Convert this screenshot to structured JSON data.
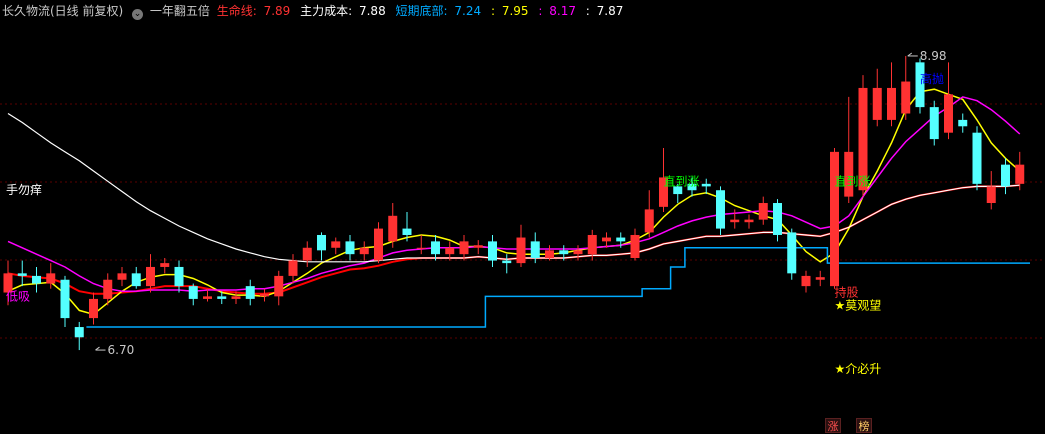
{
  "header": {
    "stock_name": "长久物流(日线 前复权)",
    "indicator_name": "一年翻五倍",
    "life_line_label": "生命线:",
    "life_line_value": "7.89",
    "main_cost_label": "主力成本:",
    "main_cost_value": "7.88",
    "short_bottom_label": "短期底部:",
    "short_bottom_v1": "7.24",
    "sep1": ":",
    "short_bottom_v2": "7.95",
    "sep2": ":",
    "short_bottom_v3": "8.17",
    "sep3": ":",
    "short_bottom_v4": "7.87"
  },
  "colors": {
    "up": "#ff3232",
    "down": "#54ffff",
    "ma_short": "#ffff00",
    "ma_mid": "#ff00ff",
    "life_line": "#ff0000",
    "main_cost": "#ffffff",
    "bottom_line": "#00aaff"
  },
  "badges": {
    "zhang": "涨",
    "bang": "榜"
  },
  "chart_data": {
    "type": "candlestick",
    "ylim": [
      6.2,
      9.25
    ],
    "candles": [
      [
        7.15,
        7.3,
        7.4,
        7.05
      ],
      [
        7.3,
        7.28,
        7.4,
        7.2
      ],
      [
        7.28,
        7.22,
        7.35,
        7.15
      ],
      [
        7.22,
        7.3,
        7.38,
        7.18
      ],
      [
        7.25,
        6.95,
        7.28,
        6.88
      ],
      [
        6.88,
        6.8,
        6.92,
        6.7
      ],
      [
        6.95,
        7.1,
        7.15,
        6.9
      ],
      [
        7.1,
        7.25,
        7.3,
        7.05
      ],
      [
        7.25,
        7.3,
        7.35,
        7.2
      ],
      [
        7.3,
        7.2,
        7.35,
        7.18
      ],
      [
        7.2,
        7.35,
        7.45,
        7.15
      ],
      [
        7.35,
        7.38,
        7.42,
        7.3
      ],
      [
        7.35,
        7.2,
        7.4,
        7.15
      ],
      [
        7.2,
        7.1,
        7.22,
        7.05
      ],
      [
        7.1,
        7.12,
        7.18,
        7.08
      ],
      [
        7.12,
        7.1,
        7.16,
        7.06
      ],
      [
        7.1,
        7.12,
        7.16,
        7.06
      ],
      [
        7.2,
        7.1,
        7.25,
        7.05
      ],
      [
        7.12,
        7.14,
        7.18,
        7.08
      ],
      [
        7.12,
        7.28,
        7.32,
        7.05
      ],
      [
        7.28,
        7.4,
        7.45,
        7.22
      ],
      [
        7.4,
        7.5,
        7.55,
        7.35
      ],
      [
        7.6,
        7.48,
        7.62,
        7.4
      ],
      [
        7.5,
        7.55,
        7.58,
        7.45
      ],
      [
        7.55,
        7.45,
        7.6,
        7.4
      ],
      [
        7.45,
        7.5,
        7.55,
        7.4
      ],
      [
        7.4,
        7.65,
        7.7,
        7.38
      ],
      [
        7.55,
        7.75,
        7.85,
        7.5
      ],
      [
        7.65,
        7.6,
        7.78,
        7.55
      ],
      [
        7.5,
        7.5,
        7.6,
        7.45
      ],
      [
        7.55,
        7.45,
        7.6,
        7.4
      ],
      [
        7.45,
        7.5,
        7.55,
        7.4
      ],
      [
        7.45,
        7.55,
        7.6,
        7.4
      ],
      [
        7.5,
        7.52,
        7.56,
        7.45
      ],
      [
        7.55,
        7.4,
        7.6,
        7.35
      ],
      [
        7.4,
        7.38,
        7.45,
        7.3
      ],
      [
        7.38,
        7.58,
        7.68,
        7.35
      ],
      [
        7.55,
        7.42,
        7.62,
        7.38
      ],
      [
        7.42,
        7.48,
        7.52,
        7.4
      ],
      [
        7.48,
        7.45,
        7.52,
        7.4
      ],
      [
        7.45,
        7.48,
        7.52,
        7.4
      ],
      [
        7.45,
        7.6,
        7.64,
        7.4
      ],
      [
        7.55,
        7.58,
        7.62,
        7.5
      ],
      [
        7.58,
        7.55,
        7.62,
        7.5
      ],
      [
        7.42,
        7.6,
        7.65,
        7.4
      ],
      [
        7.62,
        7.8,
        7.95,
        7.58
      ],
      [
        7.82,
        8.05,
        8.28,
        7.78
      ],
      [
        7.98,
        7.92,
        8.0,
        7.85
      ],
      [
        8.0,
        7.95,
        8.05,
        7.9
      ],
      [
        8.0,
        7.98,
        8.04,
        7.92
      ],
      [
        7.95,
        7.65,
        7.98,
        7.6
      ],
      [
        7.7,
        7.72,
        7.8,
        7.65
      ],
      [
        7.7,
        7.72,
        7.76,
        7.65
      ],
      [
        7.72,
        7.85,
        7.9,
        7.68
      ],
      [
        7.85,
        7.6,
        7.88,
        7.55
      ],
      [
        7.62,
        7.3,
        7.65,
        7.25
      ],
      [
        7.2,
        7.28,
        7.32,
        7.15
      ],
      [
        7.25,
        7.27,
        7.32,
        7.2
      ],
      [
        7.2,
        8.25,
        8.28,
        7.18
      ],
      [
        7.9,
        8.25,
        8.68,
        7.85
      ],
      [
        7.95,
        8.75,
        8.85,
        7.9
      ],
      [
        8.5,
        8.75,
        8.9,
        8.45
      ],
      [
        8.5,
        8.75,
        8.95,
        8.45
      ],
      [
        8.55,
        8.8,
        9.0,
        8.5
      ],
      [
        8.95,
        8.6,
        8.98,
        8.55
      ],
      [
        8.6,
        8.35,
        8.65,
        8.3
      ],
      [
        8.4,
        8.7,
        8.95,
        8.35
      ],
      [
        8.5,
        8.45,
        8.55,
        8.4
      ],
      [
        8.4,
        8.0,
        8.45,
        7.95
      ],
      [
        7.85,
        7.98,
        8.1,
        7.8
      ],
      [
        8.15,
        7.98,
        8.2,
        7.92
      ],
      [
        8.0,
        8.15,
        8.25,
        7.95
      ]
    ],
    "series": [
      {
        "name": "生命线",
        "values": [
          7.3,
          7.28,
          7.27,
          7.26,
          7.22,
          7.16,
          7.14,
          7.14,
          7.15,
          7.16,
          7.18,
          7.2,
          7.2,
          7.2,
          7.18,
          7.16,
          7.15,
          7.14,
          7.14,
          7.15,
          7.19,
          7.23,
          7.27,
          7.3,
          7.33,
          7.34,
          7.36,
          7.39,
          7.41,
          7.42,
          7.42,
          7.42,
          7.42,
          7.43,
          7.42,
          7.41,
          7.42,
          7.42,
          7.42,
          7.42,
          7.43,
          7.44,
          7.44,
          7.45,
          7.46,
          7.49,
          7.53,
          7.55,
          7.57,
          7.59,
          7.59,
          7.6,
          7.61,
          7.62,
          7.62,
          7.61,
          7.6,
          7.59,
          7.62,
          7.66,
          7.72,
          7.78,
          7.84,
          7.88,
          7.91,
          7.93,
          7.95,
          7.97,
          7.98,
          7.98,
          7.98,
          7.99
        ]
      },
      {
        "name": "",
        "values": [
          7.16,
          7.21,
          7.22,
          7.23,
          7.14,
          7.01,
          6.98,
          7.07,
          7.16,
          7.23,
          7.27,
          7.29,
          7.29,
          7.26,
          7.21,
          7.15,
          7.13,
          7.13,
          7.12,
          7.16,
          7.23,
          7.3,
          7.38,
          7.43,
          7.48,
          7.5,
          7.51,
          7.55,
          7.58,
          7.6,
          7.59,
          7.56,
          7.51,
          7.51,
          7.5,
          7.46,
          7.45,
          7.45,
          7.45,
          7.46,
          7.48,
          7.5,
          7.51,
          7.52,
          7.56,
          7.62,
          7.74,
          7.84,
          7.91,
          7.93,
          7.89,
          7.83,
          7.79,
          7.75,
          7.72,
          7.6,
          7.47,
          7.39,
          7.46,
          7.65,
          7.9,
          8.1,
          8.32,
          8.58,
          8.72,
          8.74,
          8.7,
          8.66,
          8.5,
          8.32,
          8.2,
          8.1
        ]
      },
      {
        "name": "",
        "values": [
          7.55,
          7.5,
          7.45,
          7.4,
          7.35,
          7.28,
          7.22,
          7.18,
          7.16,
          7.16,
          7.17,
          7.17,
          7.17,
          7.16,
          7.17,
          7.17,
          7.17,
          7.18,
          7.18,
          7.2,
          7.23,
          7.26,
          7.3,
          7.33,
          7.36,
          7.38,
          7.42,
          7.46,
          7.48,
          7.49,
          7.5,
          7.5,
          7.5,
          7.51,
          7.5,
          7.49,
          7.49,
          7.49,
          7.49,
          7.49,
          7.49,
          7.5,
          7.51,
          7.52,
          7.54,
          7.57,
          7.62,
          7.67,
          7.71,
          7.74,
          7.76,
          7.77,
          7.78,
          7.79,
          7.78,
          7.75,
          7.7,
          7.65,
          7.67,
          7.75,
          7.9,
          8.05,
          8.2,
          8.33,
          8.43,
          8.53,
          8.6,
          8.68,
          8.65,
          8.58,
          8.49,
          8.39
        ]
      },
      {
        "name": "主力成本",
        "values": [
          8.55,
          8.48,
          8.4,
          8.32,
          8.25,
          8.18,
          8.1,
          8.02,
          7.94,
          7.86,
          7.79,
          7.73,
          7.67,
          7.62,
          7.57,
          7.53,
          7.49,
          7.46,
          7.43,
          7.41,
          7.4,
          7.39,
          7.39,
          7.39,
          7.39,
          7.39,
          7.4,
          7.41,
          7.42,
          7.42,
          7.42,
          7.42,
          7.42,
          7.43,
          7.42,
          7.41,
          7.42,
          7.42,
          7.42,
          7.42,
          7.43,
          7.44,
          7.44,
          7.45,
          7.46,
          7.49,
          7.53,
          7.55,
          7.57,
          7.59,
          7.59,
          7.6,
          7.61,
          7.62,
          7.62,
          7.61,
          7.6,
          7.59,
          7.62,
          7.66,
          7.72,
          7.78,
          7.84,
          7.88,
          7.91,
          7.93,
          7.95,
          7.97,
          7.98,
          7.98,
          7.98,
          7.99
        ]
      },
      {
        "name": "短期底部",
        "values": [
          null,
          null,
          null,
          null,
          null,
          null,
          6.88,
          6.88,
          6.88,
          6.88,
          6.88,
          6.88,
          6.88,
          6.88,
          6.88,
          6.88,
          6.88,
          6.88,
          6.88,
          6.88,
          6.88,
          6.88,
          6.88,
          6.88,
          6.88,
          6.88,
          6.88,
          6.88,
          6.88,
          6.88,
          6.88,
          6.88,
          6.88,
          6.88,
          7.12,
          7.12,
          7.12,
          7.12,
          7.12,
          7.12,
          7.12,
          7.12,
          7.12,
          7.12,
          7.12,
          7.18,
          7.18,
          7.35,
          7.5,
          7.5,
          7.5,
          7.5,
          7.5,
          7.5,
          7.5,
          7.5,
          7.5,
          7.5,
          7.38,
          7.38,
          7.38,
          7.38,
          7.38,
          7.38,
          7.38,
          7.38,
          7.38,
          7.38,
          7.38,
          7.38,
          7.38,
          7.38
        ]
      }
    ],
    "annotations": [
      {
        "text": "手勿痒",
        "color": "#ffffff",
        "idx": 0,
        "y": 7.95
      },
      {
        "text": "低吸",
        "color": "#ff00ff",
        "idx": 0,
        "y": 7.12
      },
      {
        "text": "6.70",
        "color": "#c8c8c8",
        "idx": 6,
        "y": 6.7,
        "arrow": true
      },
      {
        "text": "8.98",
        "color": "#c8c8c8",
        "idx": 63,
        "y": 9.0,
        "arrow": true
      },
      {
        "text": "直到涨",
        "color": "#00ff00",
        "idx": 46,
        "y": 8.02
      },
      {
        "text": "直到涨",
        "color": "#00ff00",
        "idx": 58,
        "y": 8.02
      },
      {
        "text": "高抛",
        "color": "#0000ff",
        "idx": 64,
        "y": 8.82
      },
      {
        "text": "持股",
        "color": "#ff3232",
        "idx": 58,
        "y": 7.15
      },
      {
        "text": "★莫观望",
        "color": "#ffff00",
        "idx": 58,
        "y": 7.05
      },
      {
        "text": "★介必升",
        "color": "#ffff00",
        "idx": 58,
        "y": 6.55
      }
    ]
  }
}
